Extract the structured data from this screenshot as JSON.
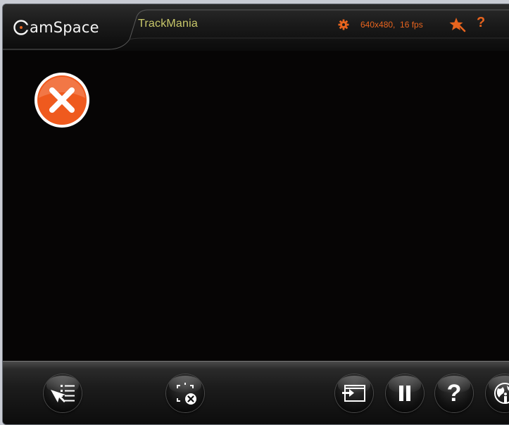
{
  "header": {
    "logo_text": "amSpace",
    "app_title": "TrackMania",
    "resolution_label": "640x480,  16 fps",
    "help_glyph": "?"
  },
  "icons": {
    "settings": "gear-icon",
    "favorite": "star-icon",
    "help": "help-icon",
    "close": "close-icon"
  },
  "bottombar": {
    "help_glyph": "?",
    "buttons": [
      {
        "name": "controls-list-button",
        "icon": "cursor-list-icon"
      },
      {
        "name": "exit-fullscreen-button",
        "icon": "frame-close-icon"
      },
      {
        "name": "input-screen-button",
        "icon": "screen-input-icon"
      },
      {
        "name": "pause-button",
        "icon": "pause-icon"
      },
      {
        "name": "help-button",
        "icon": "question-icon"
      },
      {
        "name": "web-info-button",
        "icon": "globe-info-icon"
      }
    ]
  },
  "colors": {
    "accent": "#e8641e",
    "title": "#c9c86a",
    "background": "#060505",
    "close_button": "#ef5a1e"
  }
}
